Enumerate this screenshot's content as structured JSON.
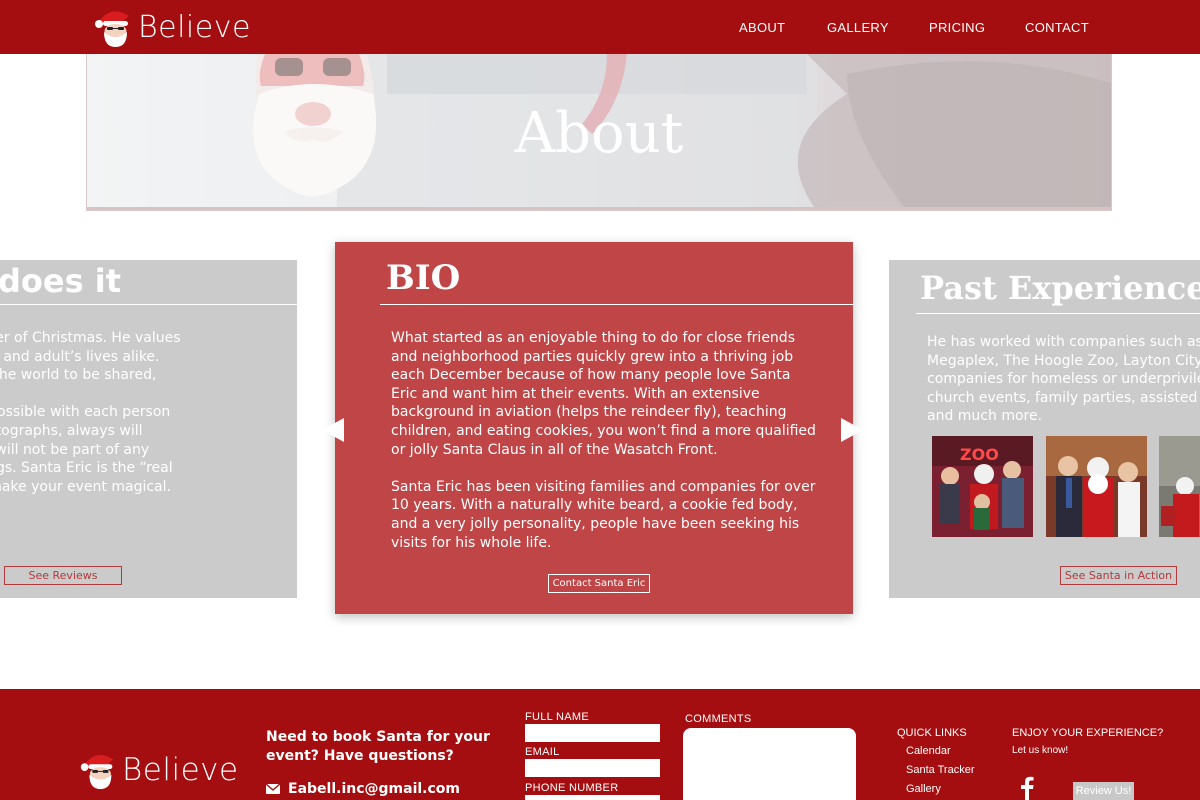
{
  "brand": {
    "name": "Believe"
  },
  "nav": {
    "items": [
      "ABOUT",
      "GALLERY",
      "PRICING",
      "CONTACT"
    ]
  },
  "hero": {
    "title": "About"
  },
  "carousel": {
    "left": {
      "title_visible": "does it",
      "paragraphs": [
        [
          "ves in the power of Christmas. He values",
          "lays in children and adult’s lives alike.",
          "s goodness in the world to be shared,"
        ],
        [
          "nuch time as possible with each person",
          "charge for photographs, always will",
          "dy canes, and will not be part of any",
          "ol or adult things. Santa Eric is the “real",
          "uaranteed to make your event magical."
        ]
      ],
      "button": "See Reviews"
    },
    "center": {
      "title": "BIO",
      "paragraphs": [
        [
          "What started as an enjoyable thing to do for close friends",
          "and neighborhood parties quickly grew into a thriving job",
          "each December because of how many people love Santa",
          "Eric and want him at their events. With an extensive",
          "background in aviation (helps the reindeer fly), teaching",
          "children, and eating cookies, you won’t find a more qualified",
          "or jolly Santa Claus in all of the Wasatch Front."
        ],
        [
          "Santa Eric has been visiting families and companies for over",
          "10 years. With a naturally white beard, a cookie fed body,",
          "and a very jolly personality, people have been seeking his",
          "visits for his whole life."
        ]
      ],
      "button": "Contact Santa Eric"
    },
    "right": {
      "title": "Past Experience",
      "lines": [
        "He has worked with companies such as",
        "Megaplex, The Hoogle Zoo, Layton City",
        "companies for homeless or underprivileg",
        "church events, family parties, assisted liv",
        "and much more."
      ],
      "photo_sign_text": "ZOO",
      "button": "See Santa in Action"
    }
  },
  "footer": {
    "heading": "Need to book Santa for your event? Have questions?",
    "email": "Eabell.inc@gmail.com",
    "form": {
      "full_name_label": "FULL NAME",
      "email_label": "EMAIL",
      "phone_label": "PHONE NUMBER",
      "comments_label": "COMMENTS"
    },
    "quick_links": {
      "heading": "QUICK LINKS",
      "items": [
        "Calendar",
        "Santa Tracker",
        "Gallery"
      ]
    },
    "enjoy": {
      "heading": "ENJOY YOUR EXPERIENCE?",
      "sub": "Let us know!",
      "button": "Review Us!"
    }
  },
  "colors": {
    "brand_red": "#a50e10",
    "card_red": "#bf4547",
    "card_gray": "#cbcbcb"
  }
}
